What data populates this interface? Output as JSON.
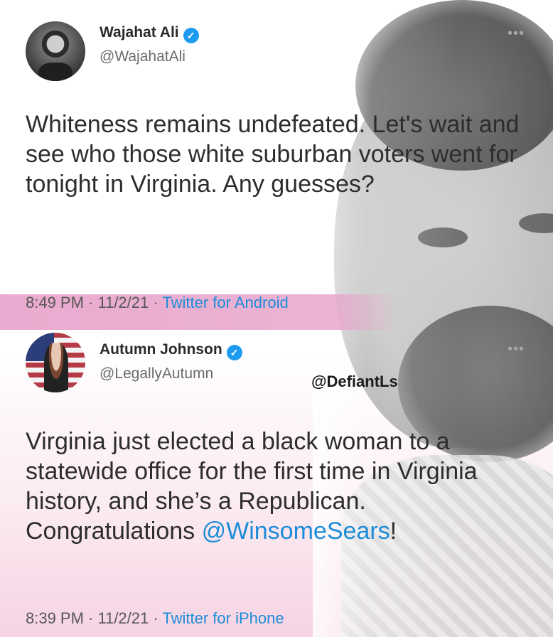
{
  "tweet1": {
    "name": "Wajahat Ali",
    "handle": "@WajahatAli",
    "more": "•••",
    "text": "Whiteness remains undefeated. Let's wait and see who those white suburban voters went for tonight in Virginia. Any guesses?",
    "time": "8:49 PM · 11/2/21 · ",
    "source": "Twitter for Android"
  },
  "tweet2": {
    "name": "Autumn Johnson",
    "handle": "@LegallyAutumn",
    "more": "•••",
    "text_before": "Virginia just elected a black woman to a statewide office for the first time in Virginia history, and she’s a Republican. Congratulations ",
    "mention": "@WinsomeSears",
    "text_after": "!",
    "time": "8:39 PM · 11/2/21 · ",
    "source": "Twitter for iPhone"
  },
  "watermark": "@DefiantLs",
  "verified_glyph": "✓",
  "colors": {
    "link": "#1d8cd8",
    "verified": "#1d9bf0",
    "band": "#e8a6cc"
  }
}
